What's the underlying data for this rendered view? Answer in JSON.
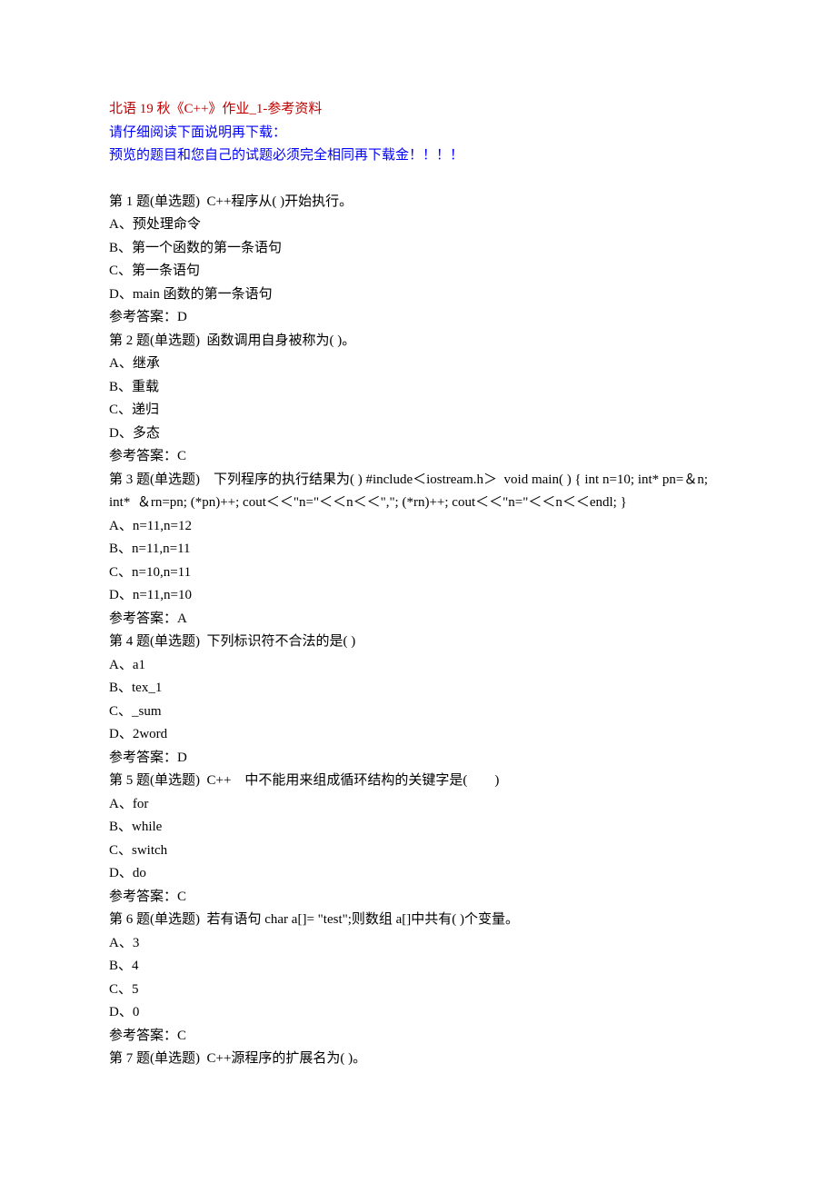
{
  "header": {
    "title": "北语 19 秋《C++》作业_1-参考资料",
    "note1": "请仔细阅读下面说明再下载：",
    "note2": "预览的题目和您自己的试题必须完全相同再下载金！！！！"
  },
  "questions": [
    {
      "stem": "第 1 题(单选题)  C++程序从( )开始执行。",
      "options": [
        "A、预处理命令",
        "B、第一个函数的第一条语句",
        "C、第一条语句",
        "D、main 函数的第一条语句"
      ],
      "answer": "参考答案：D"
    },
    {
      "stem": "第 2 题(单选题)  函数调用自身被称为( )。",
      "options": [
        "A、继承",
        "B、重载",
        "C、递归",
        "D、多态"
      ],
      "answer": "参考答案：C"
    },
    {
      "stem": "第 3 题(单选题)    下列程序的执行结果为( ) #include＜iostream.h＞  void main( ) { int n=10; int* pn=＆n; int*  ＆rn=pn; (*pn)++; cout＜＜\"n=\"＜＜n＜＜\",\"; (*rn)++; cout＜＜\"n=\"＜＜n＜＜endl; }",
      "options": [
        "A、n=11,n=12",
        "B、n=11,n=11",
        "C、n=10,n=11",
        "D、n=11,n=10"
      ],
      "answer": "参考答案：A"
    },
    {
      "stem": "第 4 题(单选题)  下列标识符不合法的是( )",
      "options": [
        "A、a1",
        "B、tex_1",
        "C、_sum",
        "D、2word"
      ],
      "answer": "参考答案：D"
    },
    {
      "stem": "第 5 题(单选题)  C++    中不能用来组成循环结构的关键字是(        )",
      "options": [
        "A、for",
        "B、while",
        "C、switch",
        "D、do"
      ],
      "answer": "参考答案：C"
    },
    {
      "stem": "第 6 题(单选题)  若有语句 char a[]= \"test\";则数组 a[]中共有( )个变量。",
      "options": [
        "A、3",
        "B、4",
        "C、5",
        "D、0"
      ],
      "answer": "参考答案：C"
    },
    {
      "stem": "第 7 题(单选题)  C++源程序的扩展名为( )。",
      "options": [],
      "answer": ""
    }
  ]
}
